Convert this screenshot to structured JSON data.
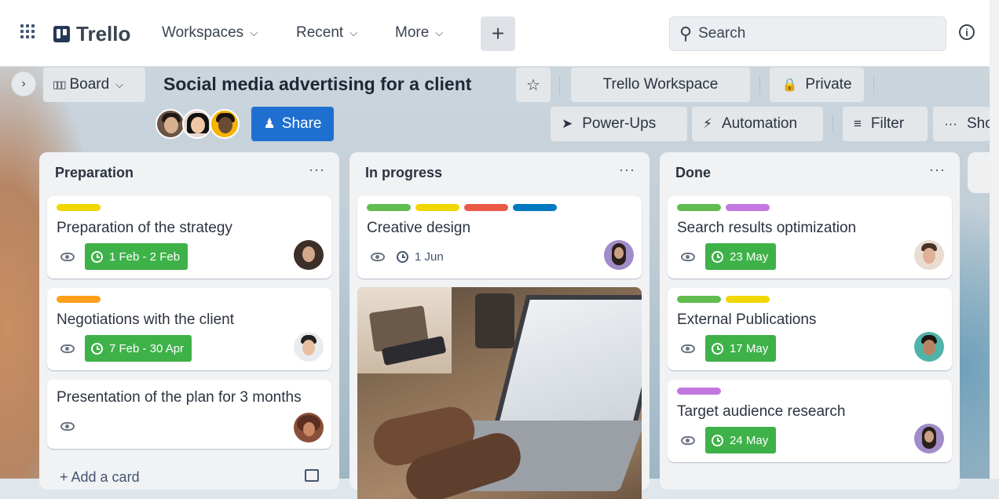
{
  "nav": {
    "logo": "Trello",
    "workspaces": "Workspaces",
    "recent": "Recent",
    "more": "More",
    "create": "+",
    "search_placeholder": "Search",
    "info": "i"
  },
  "board": {
    "view_button": "Board",
    "title": "Social media advertising for a client",
    "workspace_button": "Trello Workspace",
    "visibility_button": "Private",
    "share_button": "Share",
    "powerups_button": "Power-Ups",
    "automation_button": "Automation",
    "filter_button": "Filter",
    "show_menu_button": "Sho"
  },
  "lists": [
    {
      "title": "Preparation",
      "menu": "···",
      "add_card": "+ Add a card",
      "cards": [
        {
          "title": "Preparation of the strategy",
          "labels": [
            "#f2d600"
          ],
          "due": "1 Feb - 2 Feb"
        },
        {
          "title": "Negotiations with the client",
          "labels": [
            "#ff9f1a"
          ],
          "due": "7 Feb - 30 Apr"
        },
        {
          "title": "Presentation of the plan for 3 months",
          "labels": [],
          "due": ""
        }
      ]
    },
    {
      "title": "In progress",
      "menu": "···",
      "cards": [
        {
          "title": "Creative design",
          "labels": [
            "#61bd4f",
            "#f2d600",
            "#eb5a46",
            "#0079bf"
          ],
          "due": "1 Jun"
        }
      ]
    },
    {
      "title": "Done",
      "menu": "···",
      "cards": [
        {
          "title": "Search results optimization",
          "labels": [
            "#61bd4f",
            "#c377e0"
          ],
          "due": "23 May"
        },
        {
          "title": "External Publications",
          "labels": [
            "#61bd4f",
            "#f2d600"
          ],
          "due": "17 May"
        },
        {
          "title": "Target audience research",
          "labels": [
            "#c377e0"
          ],
          "due": "24 May"
        }
      ]
    }
  ],
  "colors": {
    "share_blue": "#1f6fd1",
    "due_green": "#3fb149"
  }
}
